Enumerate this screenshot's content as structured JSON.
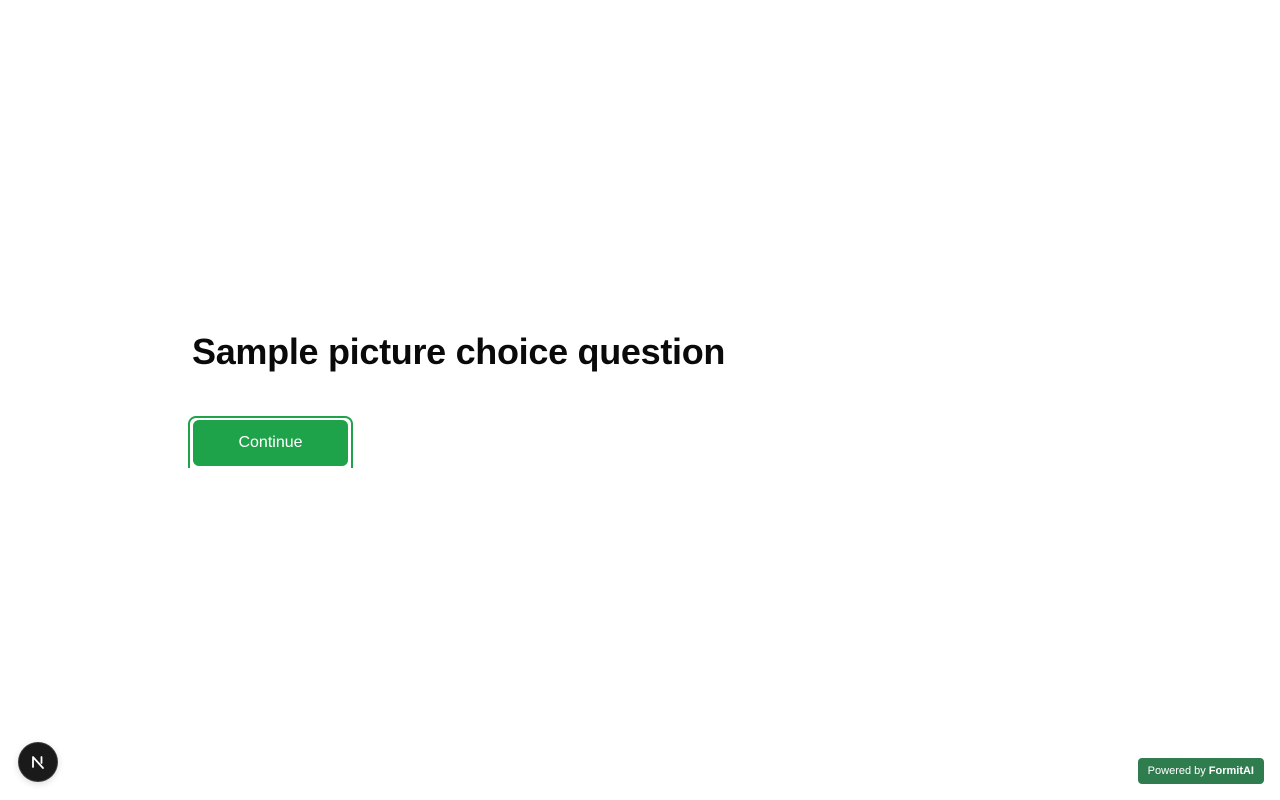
{
  "question": {
    "title": "Sample picture choice question"
  },
  "actions": {
    "continue_label": "Continue"
  },
  "dev_badge": {
    "letter": "N",
    "icon": "nextjs-n-icon"
  },
  "footer": {
    "powered_prefix": "Powered by",
    "powered_brand": "FormitAI"
  },
  "colors": {
    "accent": "#1fa34a",
    "badge_bg": "#2f7d4f",
    "dev_badge_bg": "#1a1a1a"
  }
}
